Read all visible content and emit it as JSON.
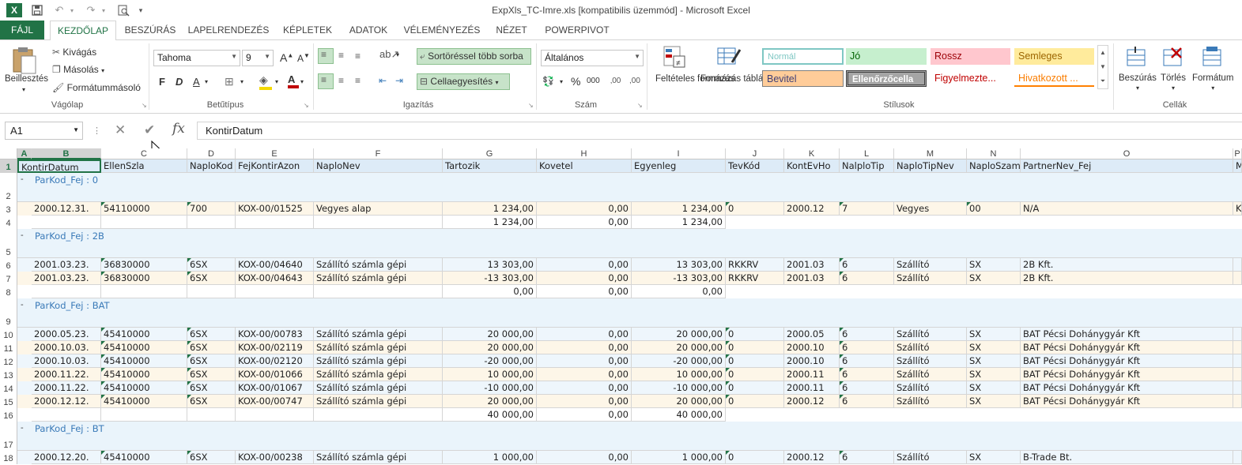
{
  "window": {
    "title": "ExpXls_TC-Imre.xls  [kompatibilis üzemmód] - Microsoft Excel"
  },
  "qat": {
    "excel_icon": "X",
    "save_icon": "save-icon",
    "undo_icon": "↶",
    "redo_icon": "↷",
    "preview_icon": "print-preview-icon",
    "more_icon": "▾"
  },
  "tabs": [
    "FÁJL",
    "KEZDŐLAP",
    "BESZÚRÁS",
    "LAPELRENDEZÉS",
    "KÉPLETEK",
    "ADATOK",
    "VÉLEMÉNYEZÉS",
    "NÉZET",
    "POWERPIVOT"
  ],
  "ribbon": {
    "clipboard": {
      "paste": "Beillesztés",
      "cut": "Kivágás",
      "copy": "Másolás",
      "format_painter": "Formátummásoló",
      "label": "Vágólap"
    },
    "font": {
      "name": "Tahoma",
      "size": "9",
      "grow": "A",
      "shrink": "A",
      "bold": "F",
      "italic": "D",
      "underline": "A",
      "font_color": "A",
      "label": "Betűtípus"
    },
    "alignment": {
      "wrap": "Sortöréssel több sorba",
      "merge": "Cellaegyesítés",
      "label": "Igazítás"
    },
    "number": {
      "format": "Általános",
      "percent": "%",
      "thousands": "000",
      "inc_dec": "‚00",
      "dec_dec": ",00",
      "label": "Szám"
    },
    "styles": {
      "conditional": "Feltételes formázás",
      "table": "Formázás táblázatként",
      "items": [
        "Normál",
        "Jó",
        "Rossz",
        "Semleges",
        "Bevitel",
        "Ellenőrzőcella",
        "Figyelmezte...",
        "Hivatkozott ..."
      ],
      "label": "Stílusok"
    },
    "cells": {
      "insert": "Beszúrás",
      "delete": "Törlés",
      "format": "Formátum",
      "label": "Cellák"
    }
  },
  "formula_bar": {
    "name_box": "A1",
    "cancel": "✕",
    "enter": "✔",
    "fx": "fx",
    "content": "KontirDatum"
  },
  "grid": {
    "columns": [
      "A",
      "B",
      "C",
      "D",
      "E",
      "F",
      "G",
      "H",
      "I",
      "J",
      "K",
      "L",
      "M",
      "N",
      "O",
      "P"
    ],
    "headers": [
      "KontirDatum",
      "EllenSzla",
      "NaploKod",
      "FejKontirAzon",
      "NaploNev",
      "Tartozik",
      "Kovetel",
      "Egyenleg",
      "TevKód",
      "KontEvHo",
      "NalploTip",
      "NaploTipNev",
      "NaploSzam",
      "PartnerNev_Fej",
      "M"
    ],
    "rows": [
      {
        "n": "2",
        "group": "ParKod_Fej : 0"
      },
      {
        "n": "3",
        "cells": [
          "2000.12.31.",
          "54110000",
          "700",
          "KOX-00/01525",
          "Vegyes alap",
          "1 234,00",
          "0,00",
          "1 234,00",
          "0",
          "2000.12",
          "7",
          "Vegyes",
          "00",
          "N/A",
          "K"
        ]
      },
      {
        "n": "4",
        "total": [
          "1 234,00",
          "0,00",
          "1 234,00"
        ]
      },
      {
        "n": "5",
        "group": "ParKod_Fej : 2B"
      },
      {
        "n": "6",
        "cells": [
          "2001.03.23.",
          "36830000",
          "6SX",
          "KOX-00/04640",
          "Szállító számla gépi",
          "13 303,00",
          "0,00",
          "13 303,00",
          "RKKRV",
          "2001.03",
          "6",
          "Szállító",
          "SX",
          "2B Kft.",
          ""
        ]
      },
      {
        "n": "7",
        "cells": [
          "2001.03.23.",
          "36830000",
          "6SX",
          "KOX-00/04643",
          "Szállító számla gépi",
          "-13 303,00",
          "0,00",
          "-13 303,00",
          "RKKRV",
          "2001.03",
          "6",
          "Szállító",
          "SX",
          "2B Kft.",
          ""
        ]
      },
      {
        "n": "8",
        "total": [
          "0,00",
          "0,00",
          "0,00"
        ]
      },
      {
        "n": "9",
        "group": "ParKod_Fej : BAT"
      },
      {
        "n": "10",
        "cells": [
          "2000.05.23.",
          "45410000",
          "6SX",
          "KOX-00/00783",
          "Szállító számla gépi",
          "20 000,00",
          "0,00",
          "20 000,00",
          "0",
          "2000.05",
          "6",
          "Szállító",
          "SX",
          "BAT Pécsi Dohánygyár Kft",
          ""
        ]
      },
      {
        "n": "11",
        "cells": [
          "2000.10.03.",
          "45410000",
          "6SX",
          "KOX-00/02119",
          "Szállító számla gépi",
          "20 000,00",
          "0,00",
          "20 000,00",
          "0",
          "2000.10",
          "6",
          "Szállító",
          "SX",
          "BAT Pécsi Dohánygyár Kft",
          ""
        ]
      },
      {
        "n": "12",
        "cells": [
          "2000.10.03.",
          "45410000",
          "6SX",
          "KOX-00/02120",
          "Szállító számla gépi",
          "-20 000,00",
          "0,00",
          "-20 000,00",
          "0",
          "2000.10",
          "6",
          "Szállító",
          "SX",
          "BAT Pécsi Dohánygyár Kft",
          ""
        ]
      },
      {
        "n": "13",
        "cells": [
          "2000.11.22.",
          "45410000",
          "6SX",
          "KOX-00/01066",
          "Szállító számla gépi",
          "10 000,00",
          "0,00",
          "10 000,00",
          "0",
          "2000.11",
          "6",
          "Szállító",
          "SX",
          "BAT Pécsi Dohánygyár Kft",
          ""
        ]
      },
      {
        "n": "14",
        "cells": [
          "2000.11.22.",
          "45410000",
          "6SX",
          "KOX-00/01067",
          "Szállító számla gépi",
          "-10 000,00",
          "0,00",
          "-10 000,00",
          "0",
          "2000.11",
          "6",
          "Szállító",
          "SX",
          "BAT Pécsi Dohánygyár Kft",
          ""
        ]
      },
      {
        "n": "15",
        "cells": [
          "2000.12.12.",
          "45410000",
          "6SX",
          "KOX-00/00747",
          "Szállító számla gépi",
          "20 000,00",
          "0,00",
          "20 000,00",
          "0",
          "2000.12",
          "6",
          "Szállító",
          "SX",
          "BAT Pécsi Dohánygyár Kft",
          ""
        ]
      },
      {
        "n": "16",
        "total": [
          "40 000,00",
          "0,00",
          "40 000,00"
        ]
      },
      {
        "n": "17",
        "group": "ParKod_Fej : BT"
      },
      {
        "n": "18",
        "cells": [
          "2000.12.20.",
          "45410000",
          "6SX",
          "KOX-00/00238",
          "Szállító számla gépi",
          "1 000,00",
          "0,00",
          "1 000,00",
          "0",
          "2000.12",
          "6",
          "Szállító",
          "SX",
          "B-Trade Bt.",
          ""
        ]
      }
    ]
  },
  "colors": {
    "accent": "#217346",
    "header_fill": "#ddebf7",
    "group_fill": "#eaf4fb",
    "row_odd": "#fdf6e8",
    "row_even": "#eef6fc"
  }
}
